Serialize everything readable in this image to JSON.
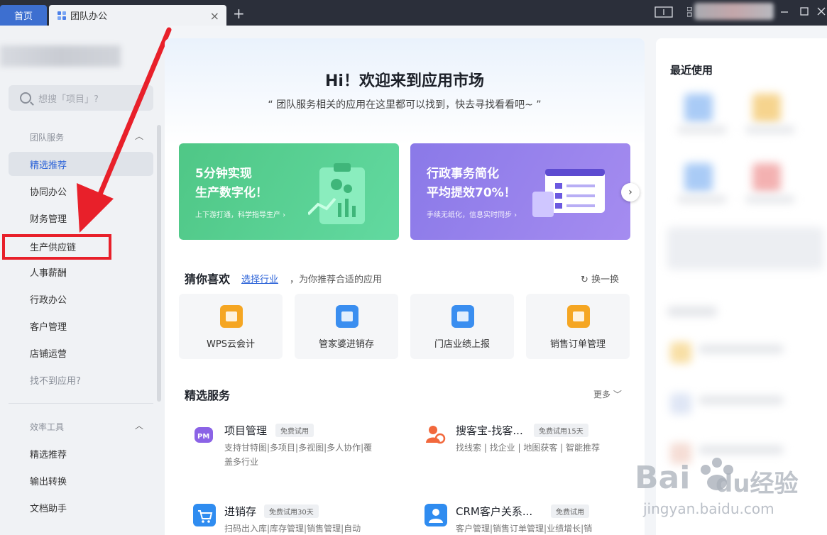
{
  "titlebar": {
    "home_tab": "首页",
    "active_tab": "团队办公",
    "close_glyph": "×",
    "add_glyph": "+"
  },
  "sidebar": {
    "search_placeholder": "想搜「项目」?",
    "group1": {
      "title": "团队服务",
      "items": [
        "精选推荐",
        "协同办公",
        "财务管理",
        "生产供应链",
        "人事薪酬",
        "行政办公",
        "客户管理",
        "店铺运营",
        "找不到应用?"
      ]
    },
    "group2": {
      "title": "效率工具",
      "items": [
        "精选推荐",
        "输出转换",
        "文档助手"
      ]
    }
  },
  "main": {
    "hero_title": "Hi！欢迎来到应用市场",
    "hero_subtitle": "“ 团队服务相关的应用在这里都可以找到，快去寻找看看吧~ ”",
    "banners": [
      {
        "title": "5分钟实现生产数字化！",
        "line1": "5分钟实现",
        "line2": "生产数字化！",
        "subtitle": "上下游打通，科学指导生产 ›",
        "color": "#4fc786"
      },
      {
        "title": "行政事务简化平均提效70%！",
        "line1": "行政事务简化",
        "line2": "平均提效70%！",
        "subtitle": "手续无纸化，信息实时同步 ›",
        "color": "#8a79e8"
      }
    ],
    "guess": {
      "title": "猜你喜欢",
      "link": "选择行业",
      "desc": "，为你推荐合适的应用",
      "refresh": "换一换",
      "items": [
        {
          "label": "WPS云会计",
          "color": "#f5a623"
        },
        {
          "label": "管家婆进销存",
          "color": "#3a8ef0"
        },
        {
          "label": "门店业绩上报",
          "color": "#3a8ef0"
        },
        {
          "label": "销售订单管理",
          "color": "#f5a623"
        }
      ]
    },
    "services": {
      "title": "精选服务",
      "more": "更多",
      "items": [
        {
          "title": "项目管理",
          "badge": "免费试用",
          "desc": "支持甘特图|多项目|多视图|多人协作|覆盖多行业",
          "color": "#8b63e6"
        },
        {
          "title": "搜客宝-找客...",
          "badge": "免费试用15天",
          "desc": "找线索 | 找企业 | 地图获客 | 智能推荐",
          "color": "#f2683c"
        },
        {
          "title": "进销存",
          "badge": "免费试用30天",
          "desc": "扫码出入库|库存管理|销售管理|自动",
          "color": "#2f8cf0"
        },
        {
          "title": "CRM客户关系...",
          "badge": "免费试用",
          "desc": "客户管理|销售订单管理|业绩增长|销",
          "color": "#2f8cf0"
        }
      ]
    }
  },
  "right_panel": {
    "title": "最近使用"
  },
  "watermark": {
    "brand": "Bai du 经验",
    "url": "jingyan.baidu.com"
  }
}
